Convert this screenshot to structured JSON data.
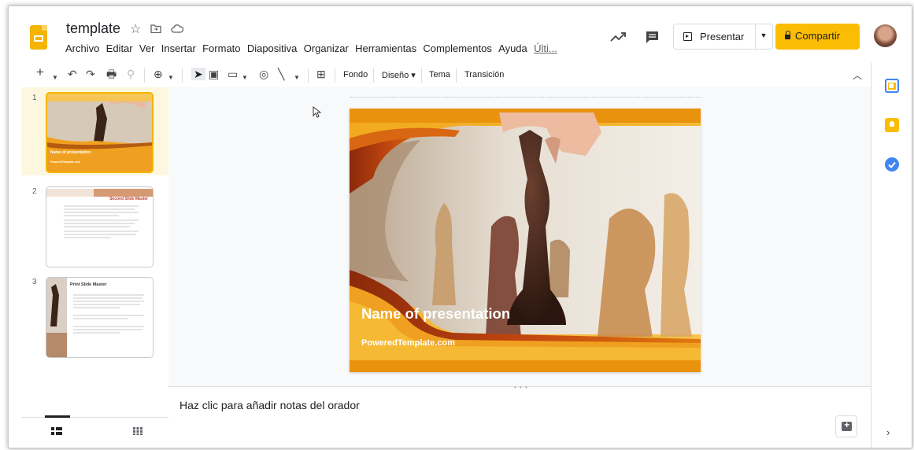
{
  "header": {
    "title": "template",
    "menu": [
      "Archivo",
      "Editar",
      "Ver",
      "Insertar",
      "Formato",
      "Diapositiva",
      "Organizar",
      "Herramientas",
      "Complementos",
      "Ayuda"
    ],
    "menu_last": "Últi...",
    "present_label": "Presentar",
    "share_label": "Compartir",
    "accent": "#fbbc04",
    "logo_color": "#f4b400"
  },
  "toolbar": {
    "fondo": "Fondo",
    "diseno": "Diseño ▾",
    "tema": "Tema",
    "transicion": "Transición"
  },
  "filmstrip": {
    "slides": [
      {
        "num": "1",
        "title": "Name of presentation",
        "sub": "PoweredTemplate.com"
      },
      {
        "num": "2",
        "title": "Second Slide Master"
      },
      {
        "num": "3",
        "title": "Print Slide Master"
      }
    ]
  },
  "slide": {
    "title": "Name of presentation",
    "subtitle": "PoweredTemplate.com"
  },
  "notes": {
    "placeholder": "Haz clic para añadir notas del orador"
  }
}
